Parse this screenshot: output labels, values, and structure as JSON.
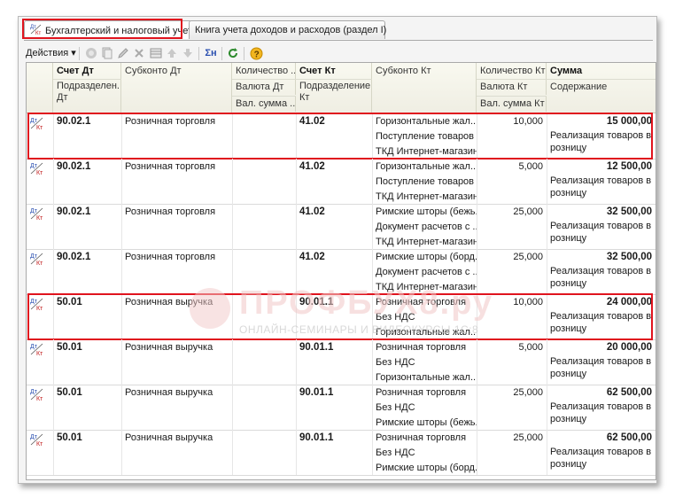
{
  "tabs": [
    {
      "label": "Бухгалтерский и налоговый учет",
      "active": true
    },
    {
      "label": "Книга учета доходов и расходов (раздел I)",
      "active": false
    }
  ],
  "toolbar": {
    "actions_label": "Действия",
    "sigma_label": "Σн"
  },
  "columns": {
    "debit_account": "Счет Дт",
    "debit_subconto": "Субконто Дт",
    "debit_qty": "Количество ...",
    "credit_account": "Счет Кт",
    "credit_subconto": "Субконто Кт",
    "credit_qty": "Количество Кт",
    "amount": "Сумма",
    "debit_division": "Подразделен... Дт",
    "debit_currency": "Валюта Дт",
    "credit_division": "Подразделение Кт",
    "credit_currency": "Валюта Кт",
    "content": "Содержание",
    "debit_val_amount": "Вал. сумма ...",
    "credit_val_amount": "Вал. сумма Кт"
  },
  "rows": [
    {
      "dt": "90.02.1",
      "sub_dt": "Розничная торговля",
      "kt": "41.02",
      "sub_kt": [
        "Горизонтальные жал...",
        "Поступление товаров ...",
        "ТКД Интернет-магазин"
      ],
      "qty": "10,000",
      "amount": "15 000,00",
      "content": "Реализация товаров в розницу",
      "highlight": true
    },
    {
      "dt": "90.02.1",
      "sub_dt": "Розничная торговля",
      "kt": "41.02",
      "sub_kt": [
        "Горизонтальные жал...",
        "Поступление товаров ...",
        "ТКД Интернет-магазин"
      ],
      "qty": "5,000",
      "amount": "12 500,00",
      "content": "Реализация товаров в розницу",
      "highlight": false
    },
    {
      "dt": "90.02.1",
      "sub_dt": "Розничная торговля",
      "kt": "41.02",
      "sub_kt": [
        "Римские шторы (бежь...",
        "Документ расчетов с ...",
        "ТКД Интернет-магазин"
      ],
      "qty": "25,000",
      "amount": "32 500,00",
      "content": "Реализация товаров в розницу",
      "highlight": false
    },
    {
      "dt": "90.02.1",
      "sub_dt": "Розничная торговля",
      "kt": "41.02",
      "sub_kt": [
        "Римские шторы (борд...",
        "Документ расчетов с ...",
        "ТКД Интернет-магазин"
      ],
      "qty": "25,000",
      "amount": "32 500,00",
      "content": "Реализация товаров в розницу",
      "highlight": false
    },
    {
      "dt": "50.01",
      "sub_dt": "Розничная выручка",
      "kt": "90.01.1",
      "sub_kt": [
        "Розничная торговля",
        "Без НДС",
        "Горизонтальные жал..."
      ],
      "qty": "10,000",
      "amount": "24 000,00",
      "content": "Реализация товаров в розницу",
      "highlight": true
    },
    {
      "dt": "50.01",
      "sub_dt": "Розничная выручка",
      "kt": "90.01.1",
      "sub_kt": [
        "Розничная торговля",
        "Без НДС",
        "Горизонтальные жал..."
      ],
      "qty": "5,000",
      "amount": "20 000,00",
      "content": "Реализация товаров в розницу",
      "highlight": false
    },
    {
      "dt": "50.01",
      "sub_dt": "Розничная выручка",
      "kt": "90.01.1",
      "sub_kt": [
        "Розничная торговля",
        "Без НДС",
        "Римские шторы (бежь..."
      ],
      "qty": "25,000",
      "amount": "62 500,00",
      "content": "Реализация товаров в розницу",
      "highlight": false
    },
    {
      "dt": "50.01",
      "sub_dt": "Розничная выручка",
      "kt": "90.01.1",
      "sub_kt": [
        "Розничная торговля",
        "Без НДС",
        "Римские шторы (борд..."
      ],
      "qty": "25,000",
      "amount": "62 500,00",
      "content": "Реализация товаров в розницу",
      "highlight": false
    }
  ],
  "watermark": {
    "title": "ПРОФБУХ8.ру",
    "subtitle": "ОНЛАЙН-СЕМИНАРЫ И ВИДЕОКУРСЫ 1С:8"
  },
  "colors": {
    "highlight": "#e0141e",
    "header_bg": "#efeee3"
  }
}
